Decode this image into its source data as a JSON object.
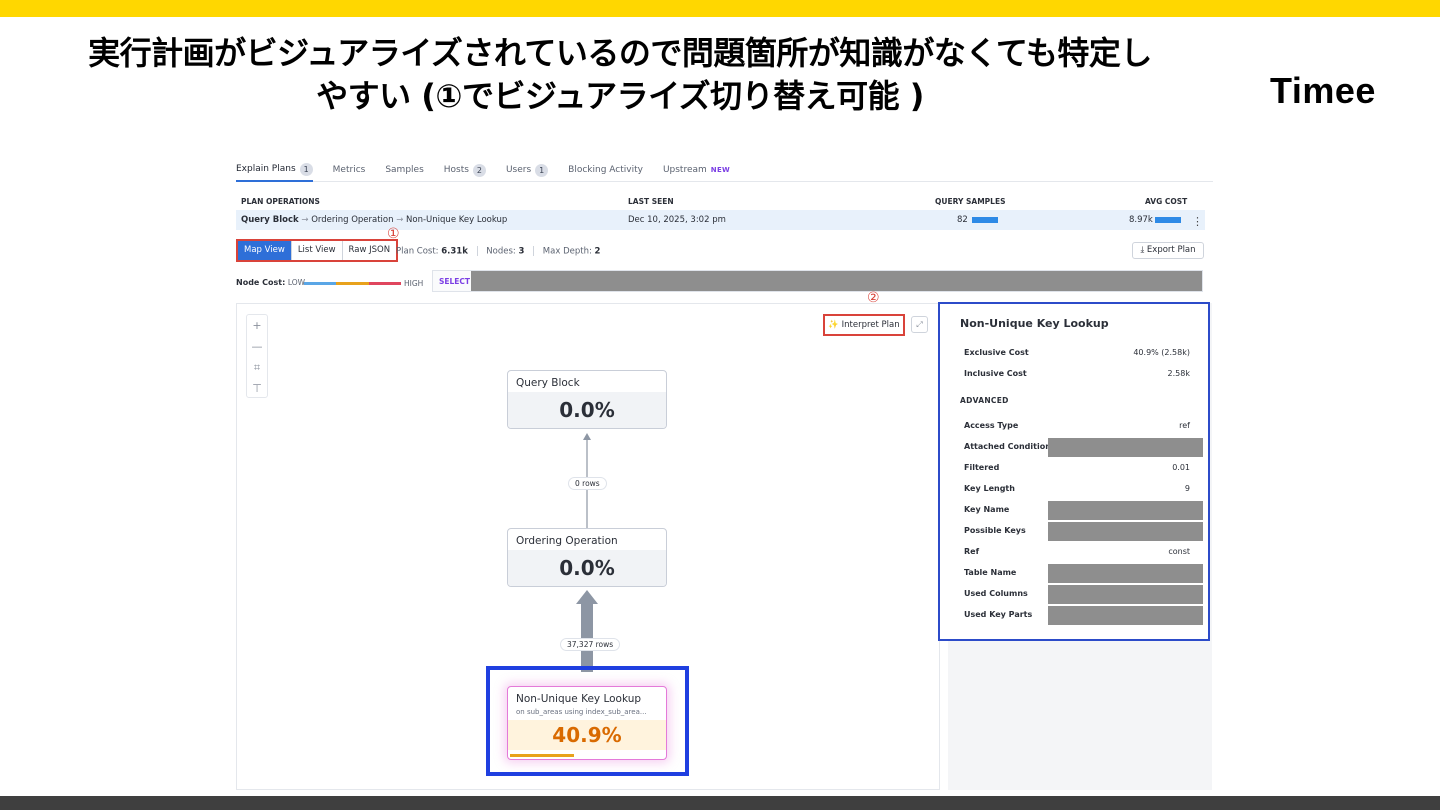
{
  "slide": {
    "headline_line1": "実行計画がビジュアライズされているので問題箇所が知識がなくても特定し",
    "headline_line2": "やすい (①でビジュアライズ切り替え可能 )",
    "brand": "Timee"
  },
  "tabs": [
    {
      "label": "Explain Plans",
      "badge": "1"
    },
    {
      "label": "Metrics"
    },
    {
      "label": "Samples"
    },
    {
      "label": "Hosts",
      "badge": "2"
    },
    {
      "label": "Users",
      "badge": "1"
    },
    {
      "label": "Blocking Activity"
    },
    {
      "label": "Upstream",
      "tag": "NEW"
    }
  ],
  "plan_table": {
    "headers": {
      "operations": "PLAN OPERATIONS",
      "last_seen": "LAST SEEN",
      "query_samples": "QUERY SAMPLES",
      "avg_cost": "AVG COST"
    },
    "row": {
      "op1": "Query Block",
      "op2": "Ordering Operation",
      "op3": "Non-Unique Key Lookup",
      "arrow": "→",
      "last_seen": "Dec 10, 2025, 3:02 pm",
      "query_samples": "82",
      "avg_cost": "8.97k",
      "samples_bar_fraction": 1.0,
      "cost_bar_fraction": 1.0
    }
  },
  "views": {
    "items": [
      "Map View",
      "List View",
      "Raw JSON"
    ],
    "active": "Map View",
    "marker1": "①"
  },
  "plan_stats": {
    "cost_label": "Plan Cost:",
    "cost_value": "6.31k",
    "nodes_label": "Nodes:",
    "nodes_value": "3",
    "depth_label": "Max Depth:",
    "depth_value": "2"
  },
  "export_label": "Export Plan",
  "node_cost": {
    "label": "Node Cost:",
    "low": "LOW",
    "high": "HIGH",
    "select_label": "SELECT"
  },
  "canvas": {
    "zoom_in": "+",
    "zoom_out": "—",
    "fit": "⌗",
    "layout": "⊤",
    "interpret_label": "Interpret Plan",
    "marker2": "②",
    "expand": "⤢"
  },
  "nodes": [
    {
      "title": "Query Block",
      "value": "0.0%"
    },
    {
      "title": "Ordering Operation",
      "value": "0.0%"
    },
    {
      "title": "Non-Unique Key Lookup",
      "subtitle": "on sub_areas using index_sub_area...",
      "value": "40.9%",
      "cost_fraction": 0.409
    }
  ],
  "edges": {
    "top_rows": "0 rows",
    "bottom_rows": "37,327 rows"
  },
  "detail_panel": {
    "title": "Non-Unique Key Lookup",
    "top_rows": [
      {
        "key": "Exclusive Cost",
        "value": "40.9% (2.58k)"
      },
      {
        "key": "Inclusive Cost",
        "value": "2.58k"
      }
    ],
    "section": "ADVANCED",
    "advanced_rows": [
      {
        "key": "Access Type",
        "value": "ref"
      },
      {
        "key": "Attached Condition",
        "value": ""
      },
      {
        "key": "Filtered",
        "value": "0.01"
      },
      {
        "key": "Key Length",
        "value": "9"
      },
      {
        "key": "Key Name",
        "value": ""
      },
      {
        "key": "Possible Keys",
        "value": ""
      },
      {
        "key": "Ref",
        "value": "const"
      },
      {
        "key": "Table Name",
        "value": ""
      },
      {
        "key": "Used Columns",
        "value": ""
      },
      {
        "key": "Used Key Parts",
        "value": ""
      }
    ]
  },
  "colors": {
    "accent": "#2e6fd8",
    "highlight_red": "#d9433a",
    "selection_blue": "#1f3fe0",
    "hot": "#d96a00",
    "brand_yellow": "#ffd700"
  }
}
